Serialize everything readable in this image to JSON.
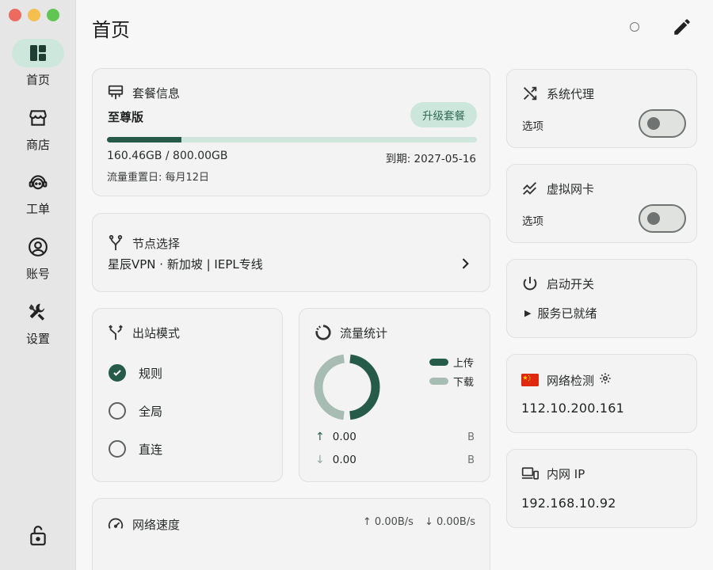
{
  "window": {
    "traffic_colors": {
      "close": "#ed6a5e",
      "minimize": "#f5bf4f",
      "zoom": "#61c554"
    }
  },
  "colors": {
    "accent": "#265b4a",
    "accent_light": "#cde7dd",
    "download": "#a7bdb4"
  },
  "sidebar": {
    "items": [
      {
        "label": "首页",
        "icon": "dashboard-icon"
      },
      {
        "label": "商店",
        "icon": "store-icon"
      },
      {
        "label": "工单",
        "icon": "support-agent-icon"
      },
      {
        "label": "账号",
        "icon": "account-icon"
      },
      {
        "label": "设置",
        "icon": "tools-icon"
      }
    ],
    "active_index": 0,
    "bottom_icon": "lock-icon"
  },
  "header": {
    "title": "首页",
    "icons": [
      "status-circle-icon",
      "edit-icon"
    ]
  },
  "plan": {
    "title": "套餐信息",
    "name": "至尊版",
    "upgrade_label": "升级套餐",
    "usage": "160.46GB / 800.00GB",
    "usage_fraction": 0.2006,
    "expire": "到期: 2027-05-16",
    "reset": "流量重置日: 每月12日"
  },
  "node": {
    "title": "节点选择",
    "value": "星辰VPN · 新加坡 | IEPL专线"
  },
  "outbound": {
    "title": "出站模式",
    "options": [
      "规则",
      "全局",
      "直连"
    ],
    "selected_index": 0
  },
  "traffic": {
    "title": "流量统计",
    "legend_upload": "上传",
    "legend_download": "下载",
    "upload_share": 0.5,
    "upload_value": "0.00",
    "download_value": "0.00",
    "unit": "B"
  },
  "speed": {
    "title": "网络速度",
    "upload": "↑ 0.00B/s",
    "download": "↓ 0.00B/s"
  },
  "proxy": {
    "title": "系统代理",
    "option_label": "选项",
    "enabled": false
  },
  "tun": {
    "title": "虚拟网卡",
    "option_label": "选项",
    "enabled": false
  },
  "service": {
    "title": "启动开关",
    "status": "服务已就绪"
  },
  "netcheck": {
    "title": "网络检测",
    "ip": "112.10.200.161",
    "flag_icon": "china-flag-icon"
  },
  "lan": {
    "title": "内网 IP",
    "ip": "192.168.10.92"
  }
}
